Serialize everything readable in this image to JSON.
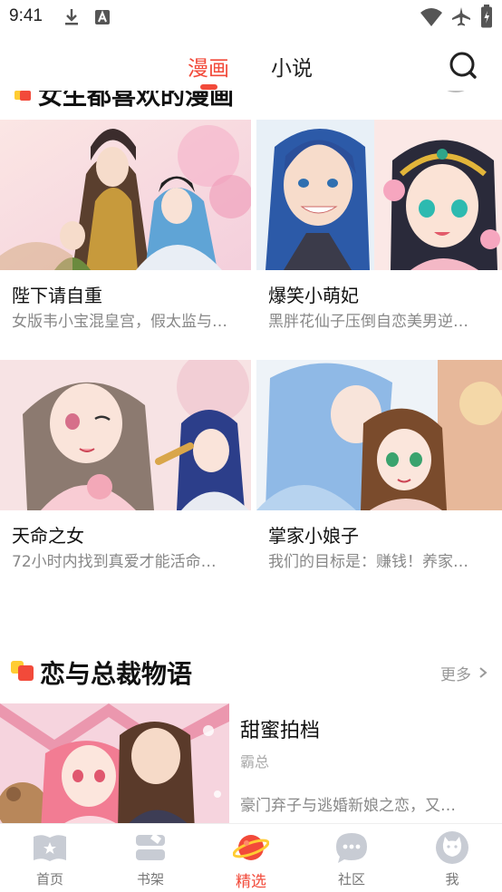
{
  "status_bar": {
    "time": "9:41"
  },
  "top_nav": {
    "tabs": [
      {
        "label": "漫画",
        "active": true
      },
      {
        "label": "小说",
        "active": false
      }
    ],
    "search_icon": "search-icon"
  },
  "peek_section": {
    "title": "女生都喜欢的漫画"
  },
  "cards": [
    {
      "title": "陛下请自重",
      "desc": "女版韦小宝混皇宫，假太监与…"
    },
    {
      "title": "爆笑小萌妃",
      "desc": "黑胖花仙子压倒自恋美男逆…"
    },
    {
      "title": "天命之女",
      "desc": "72小时内找到真爱才能活命…"
    },
    {
      "title": "掌家小娘子",
      "desc": "我们的目标是：赚钱！养家…"
    }
  ],
  "section": {
    "title": "恋与总裁物语",
    "more": "更多"
  },
  "featured": {
    "title": "甜蜜拍档",
    "tag": "霸总",
    "desc": "豪门弃子与逃婚新娘之恋，又…"
  },
  "bottom_nav": [
    {
      "label": "首页",
      "icon": "home-book-icon",
      "active": false
    },
    {
      "label": "书架",
      "icon": "bookshelf-icon",
      "active": false
    },
    {
      "label": "精选",
      "icon": "planet-icon",
      "active": true
    },
    {
      "label": "社区",
      "icon": "chat-bubble-icon",
      "active": false
    },
    {
      "label": "我",
      "icon": "profile-cat-icon",
      "active": false
    }
  ],
  "colors": {
    "accent": "#f24a3a",
    "badge_yellow": "#ffcc33",
    "inactive_icon": "#c8ccd4"
  }
}
